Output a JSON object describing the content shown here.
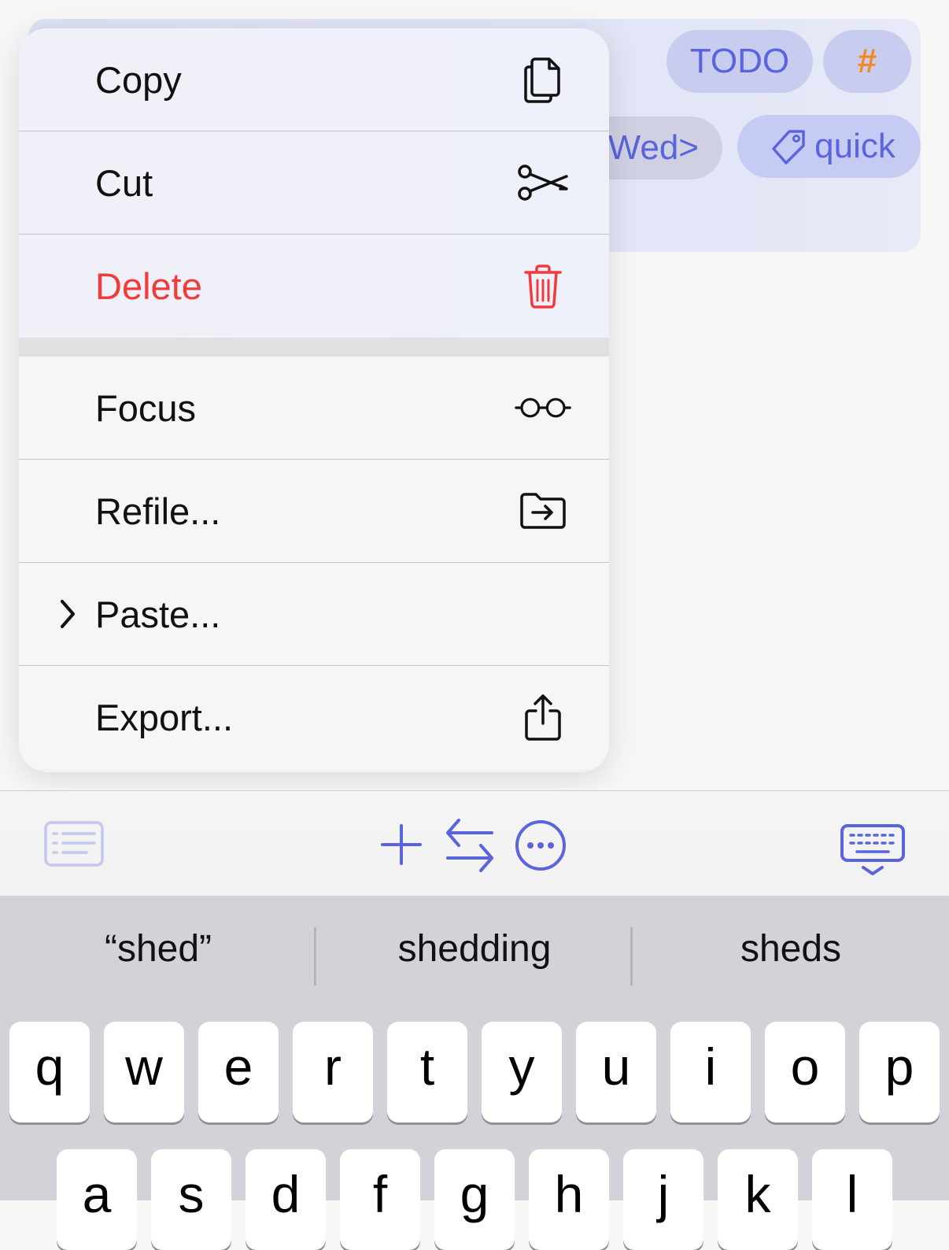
{
  "note": {
    "chips": {
      "todo": "TODO",
      "hash": "#",
      "date": "Wed>",
      "tag": "quick"
    }
  },
  "menu": {
    "items": [
      {
        "label": "Copy",
        "icon": "copy-icon"
      },
      {
        "label": "Cut",
        "icon": "scissors-icon"
      },
      {
        "label": "Delete",
        "icon": "trash-icon",
        "destructive": true
      },
      {
        "label": "Focus",
        "icon": "glasses-icon"
      },
      {
        "label": "Refile...",
        "icon": "folder-arrow-icon"
      },
      {
        "label": "Paste...",
        "icon": "chevron-right-icon"
      },
      {
        "label": "Export...",
        "icon": "share-icon"
      }
    ]
  },
  "toolbar": {
    "buttons": [
      "outline-icon",
      "plus-icon",
      "swap-arrows-icon",
      "ellipsis-circle-icon",
      "keyboard-dismiss-icon"
    ]
  },
  "keyboard": {
    "suggestions": [
      "“shed”",
      "shedding",
      "sheds"
    ],
    "row1": [
      "q",
      "w",
      "e",
      "r",
      "t",
      "y",
      "u",
      "i",
      "o",
      "p"
    ],
    "row2": [
      "a",
      "s",
      "d",
      "f",
      "g",
      "h",
      "j",
      "k",
      "l"
    ]
  },
  "colors": {
    "accent": "#5a64dc",
    "destructive": "#f23a3c",
    "hash": "#f08a24"
  }
}
